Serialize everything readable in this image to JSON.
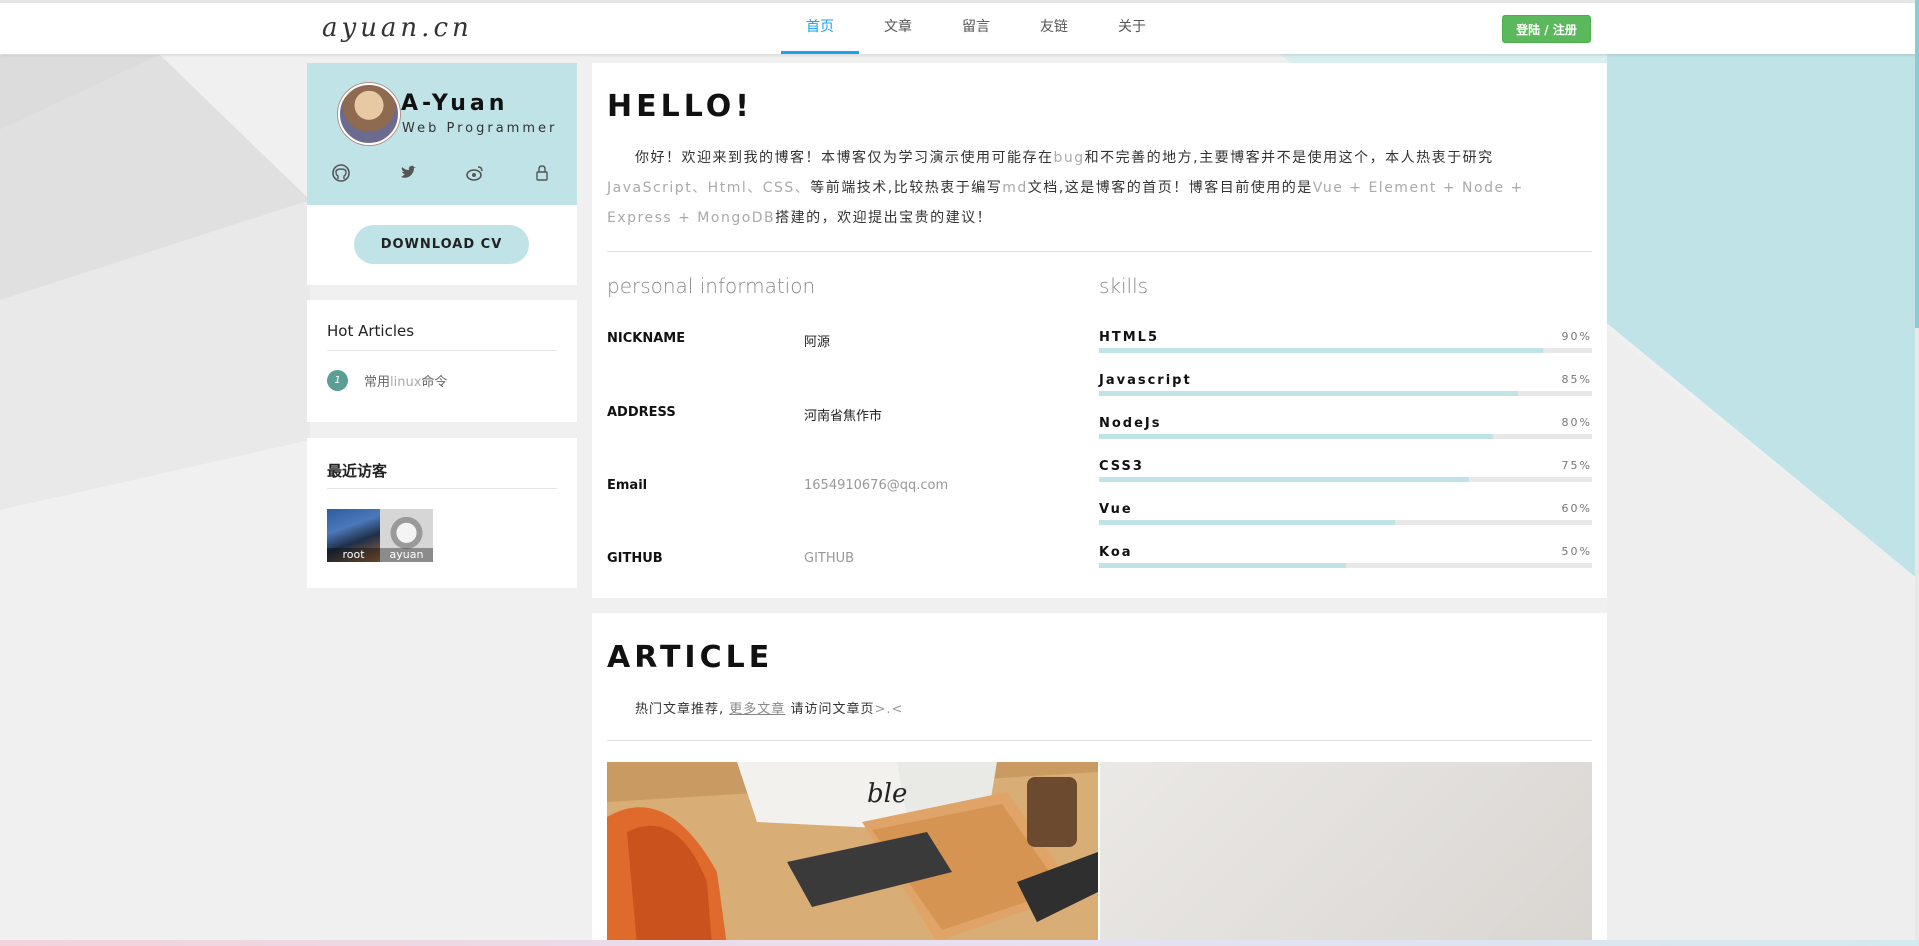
{
  "header": {
    "logo": "ayuan.cn",
    "nav": [
      {
        "label": "首页",
        "active": true
      },
      {
        "label": "文章",
        "active": false
      },
      {
        "label": "留言",
        "active": false
      },
      {
        "label": "友链",
        "active": false
      },
      {
        "label": "关于",
        "active": false
      }
    ],
    "login_label": "登陆 / 注册"
  },
  "profile": {
    "name": "A-Yuan",
    "role": "Web Programmer",
    "social_icons": [
      "github-icon",
      "twitter-icon",
      "weibo-icon",
      "lock-icon"
    ],
    "download_label": "DOWNLOAD CV"
  },
  "hot_articles": {
    "title": "Hot Articles",
    "items": [
      {
        "num": "1",
        "title_prefix": "常用",
        "title_light": "linux",
        "title_suffix": "命令"
      }
    ]
  },
  "visitors": {
    "title": "最近访客",
    "items": [
      {
        "name": "root"
      },
      {
        "name": "ayuan"
      }
    ]
  },
  "hello": {
    "title": "HELLO!",
    "intro": [
      {
        "t": "你好！欢迎来到我的博客！本博客仅为学习演示使用可能存在",
        "light": false
      },
      {
        "t": "bug",
        "light": true
      },
      {
        "t": "和不完善的地方,主要博客并不是使用这个，本人热衷于研究",
        "light": false
      },
      {
        "t": "JavaScript、Html、CSS、",
        "light": true
      },
      {
        "t": "等前端技术,比较热衷于编写",
        "light": false
      },
      {
        "t": "md",
        "light": true
      },
      {
        "t": "文档,这是博客的首页！博客目前使用的是",
        "light": false
      },
      {
        "t": "Vue + Element + Node + Express + MongoDB",
        "light": true
      },
      {
        "t": "搭建的，欢迎提出宝贵的建议！",
        "light": false
      }
    ],
    "personal_title": "personal information",
    "personal": [
      {
        "key": "NICKNAME",
        "value": "阿源",
        "light": false
      },
      {
        "key": "ADDRESS",
        "value": "河南省焦作市",
        "light": false
      },
      {
        "key": "Email",
        "value": "1654910676@qq.com",
        "light": true
      },
      {
        "key": "GITHUB",
        "value": "GITHUB",
        "light": true
      }
    ],
    "skills_title": "skills",
    "skills": [
      {
        "name": "HTML5",
        "pct_label": "90%",
        "value": 0.9
      },
      {
        "name": "Javascript",
        "pct_label": "85%",
        "value": 0.85
      },
      {
        "name": "NodeJs",
        "pct_label": "80%",
        "value": 0.8
      },
      {
        "name": "CSS3",
        "pct_label": "75%",
        "value": 0.75
      },
      {
        "name": "Vue",
        "pct_label": "60%",
        "value": 0.6
      },
      {
        "name": "Koa",
        "pct_label": "50%",
        "value": 0.5
      }
    ]
  },
  "article": {
    "title": "ARTICLE",
    "sub_prefix": "热门文章推荐,",
    "sub_link": "更多文章",
    "sub_middle": "请访问文章页",
    "sub_suffix": ">.<"
  },
  "colors": {
    "accent": "#1aa3e8",
    "profile_bg": "#bfe3e7",
    "login_green": "#5cb85c",
    "teal_bg": "#bfe3e7"
  }
}
